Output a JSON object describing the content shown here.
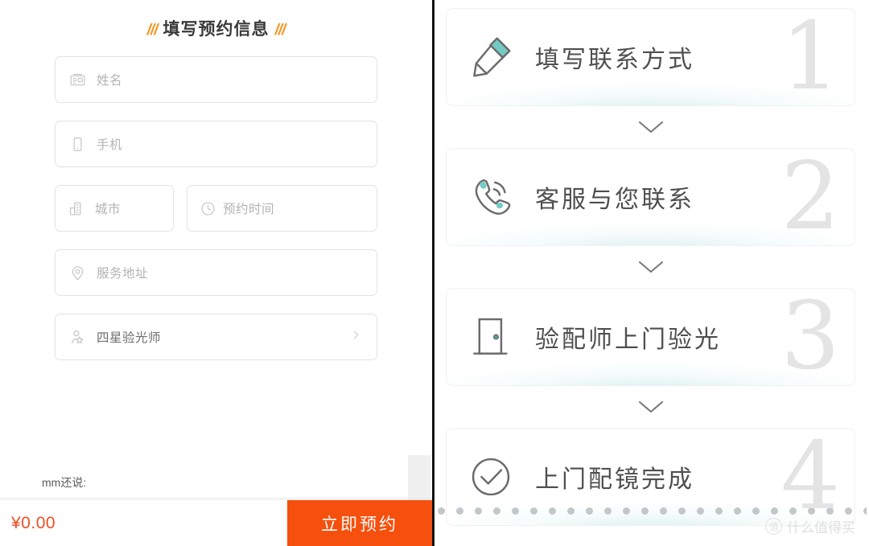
{
  "form": {
    "title_prefix": "///",
    "title": "填写预约信息",
    "title_suffix": "///",
    "fields": [
      {
        "id": "name",
        "icon": "id-card-icon",
        "placeholder": "姓名"
      },
      {
        "id": "phone",
        "icon": "mobile-icon",
        "placeholder": "手机"
      },
      {
        "id": "city",
        "icon": "building-icon",
        "placeholder": "城市"
      },
      {
        "id": "time",
        "icon": "clock-icon",
        "placeholder": "预约时间"
      },
      {
        "id": "address",
        "icon": "location-pin-icon",
        "placeholder": "服务地址"
      },
      {
        "id": "optician",
        "icon": "person-star-icon",
        "value": "四星验光师"
      }
    ],
    "note_label": "mm还说:"
  },
  "bottom": {
    "price": "¥0.00",
    "submit_label": "立即预约",
    "accent_color": "#F5500E",
    "price_color": "#F04D22"
  },
  "steps": {
    "connector_icon": "chevron-down-icon",
    "items": [
      {
        "icon": "pencil-icon",
        "label": "填写联系方式",
        "number": "1"
      },
      {
        "icon": "phone-call-icon",
        "label": "客服与您联系",
        "number": "2"
      },
      {
        "icon": "door-icon",
        "label": "验配师上门验光",
        "number": "3"
      },
      {
        "icon": "check-circle-icon",
        "label": "上门配镜完成",
        "number": "4"
      }
    ],
    "accent_color": "#74CBC6"
  },
  "watermark": {
    "mark": "值",
    "text": "什么值得买"
  }
}
